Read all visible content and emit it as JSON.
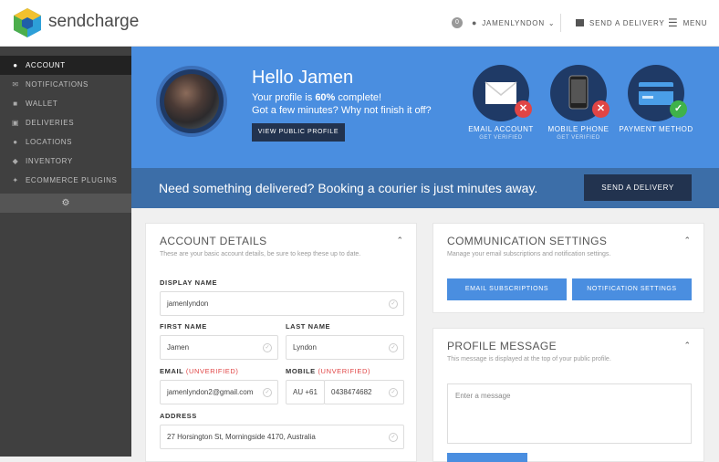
{
  "brand": {
    "name": "sendcharge"
  },
  "topbar": {
    "notif_count": "0",
    "username": "JAMENLYNDON",
    "send_label": "SEND A DELIVERY",
    "menu_label": "MENU"
  },
  "sidebar": {
    "items": [
      {
        "label": "ACCOUNT",
        "icon": "person-icon",
        "active": true
      },
      {
        "label": "NOTIFICATIONS",
        "icon": "envelope-icon"
      },
      {
        "label": "WALLET",
        "icon": "wallet-icon"
      },
      {
        "label": "DELIVERIES",
        "icon": "box-icon"
      },
      {
        "label": "LOCATIONS",
        "icon": "map-pin-icon"
      },
      {
        "label": "INVENTORY",
        "icon": "tag-icon"
      },
      {
        "label": "ECOMMERCE PLUGINS",
        "icon": "plug-icon"
      }
    ],
    "collapse_icon": "gear-icon"
  },
  "hero": {
    "greeting": "Hello Jamen",
    "line1_pre": "Your profile is ",
    "line1_pct": "60%",
    "line1_post": " complete!",
    "line2": "Got a few minutes? Why not finish it off?",
    "view_profile": "VIEW PUBLIC PROFILE",
    "verifications": [
      {
        "title": "EMAIL ACCOUNT",
        "sub": "GET VERIFIED",
        "icon": "envelope-icon",
        "status": "unverified"
      },
      {
        "title": "MOBILE PHONE",
        "sub": "GET VERIFIED",
        "icon": "mobile-phone-icon",
        "status": "unverified"
      },
      {
        "title": "PAYMENT METHOD",
        "sub": "",
        "icon": "credit-card-icon",
        "status": "verified"
      }
    ]
  },
  "banner": {
    "text": "Need something delivered? Booking a courier is just minutes away.",
    "button": "SEND A DELIVERY"
  },
  "account": {
    "title": "ACCOUNT DETAILS",
    "subtitle": "These are your basic account details, be sure to keep these up to date.",
    "display_name_label": "DISPLAY NAME",
    "display_name": "jamenlyndon",
    "first_name_label": "FIRST NAME",
    "first_name": "Jamen",
    "last_name_label": "LAST NAME",
    "last_name": "Lyndon",
    "email_label": "EMAIL",
    "email_status": "(UNVERIFIED)",
    "email": "jamenlyndon2@gmail.com",
    "mobile_label": "MOBILE",
    "mobile_status": "(UNVERIFIED)",
    "mobile_code": "AU +61",
    "mobile": "0438474682",
    "address_label": "ADDRESS",
    "address": "27 Horsington St, Morningside 4170, Australia"
  },
  "comms": {
    "title": "COMMUNICATION SETTINGS",
    "subtitle": "Manage your email subscriptions and notification settings.",
    "btn_email": "EMAIL SUBSCRIPTIONS",
    "btn_notif": "NOTIFICATION SETTINGS"
  },
  "profile_msg": {
    "title": "PROFILE MESSAGE",
    "subtitle": "This message is displayed at the top of your public profile.",
    "placeholder": "Enter a message"
  }
}
